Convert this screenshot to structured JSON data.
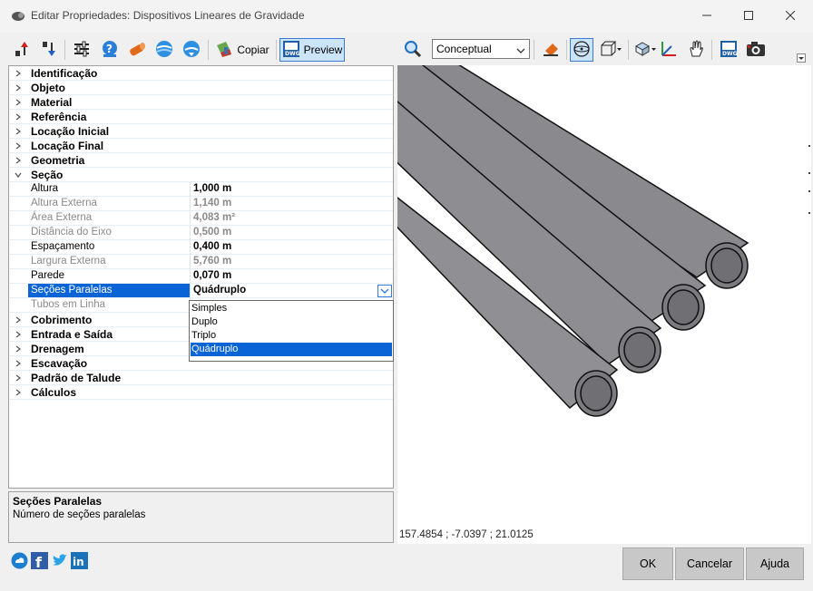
{
  "window": {
    "title": "Editar Propriedades: Dispositivos Lineares de Gravidade",
    "icons": [
      "app-pipe-icon",
      "minimize-icon",
      "maximize-icon",
      "close-icon"
    ]
  },
  "toolbar_left": {
    "copy_label": "Copiar",
    "preview_label": "Preview",
    "preview_pressed": true
  },
  "property_grid": {
    "categories": {
      "identificacao": "Identificação",
      "objeto": "Objeto",
      "material": "Material",
      "referencia": "Referência",
      "locacao_inicial": "Locação Inicial",
      "locacao_final": "Locação Final",
      "geometria": "Geometria",
      "secao": "Seção",
      "cobrimento": "Cobrimento",
      "entrada_saida": "Entrada e Saída",
      "drenagem": "Drenagem",
      "escavacao": "Escavação",
      "padrao_talude": "Padrão de Talude",
      "calculos": "Cálculos"
    },
    "secao_props": {
      "altura": {
        "label": "Altura",
        "value": "1,000 m"
      },
      "altura_externa": {
        "label": "Altura Externa",
        "value": "1,140 m"
      },
      "area_externa": {
        "label": "Área Externa",
        "value": "4,083 m²"
      },
      "distancia_eixo": {
        "label": "Distância do Eixo",
        "value": "0,500 m"
      },
      "espacamento": {
        "label": "Espaçamento",
        "value": "0,400 m"
      },
      "largura_externa": {
        "label": "Largura Externa",
        "value": "5,760 m"
      },
      "parede": {
        "label": "Parede",
        "value": "0,070 m"
      },
      "secoes_paralelas": {
        "label": "Seções Paralelas",
        "value": "Quádruplo"
      },
      "tubos_em_linha": {
        "label": "Tubos em Linha",
        "value": ""
      }
    },
    "dropdown_options": [
      "Simples",
      "Duplo",
      "Triplo",
      "Quádruplo"
    ],
    "dropdown_selected": "Quádruplo"
  },
  "description": {
    "title": "Seções Paralelas",
    "text": "Número de seções paralelas"
  },
  "toolbar_right": {
    "view_style": "Conceptual"
  },
  "viewport": {
    "coordinates": "157.4854 ; -7.0397 ; 21.0125",
    "pipe_count": 4,
    "pipe_color": "#8a8a8e"
  },
  "footer": {
    "ok_label": "OK",
    "cancel_label": "Cancelar",
    "help_label": "Ajuda",
    "social_icons": [
      "cloud-icon",
      "facebook-icon",
      "twitter-icon",
      "linkedin-icon"
    ]
  },
  "colors": {
    "selection": "#0a64d6",
    "accent_border": "#3a7bd5",
    "button_gray": "#c8c8c8"
  }
}
